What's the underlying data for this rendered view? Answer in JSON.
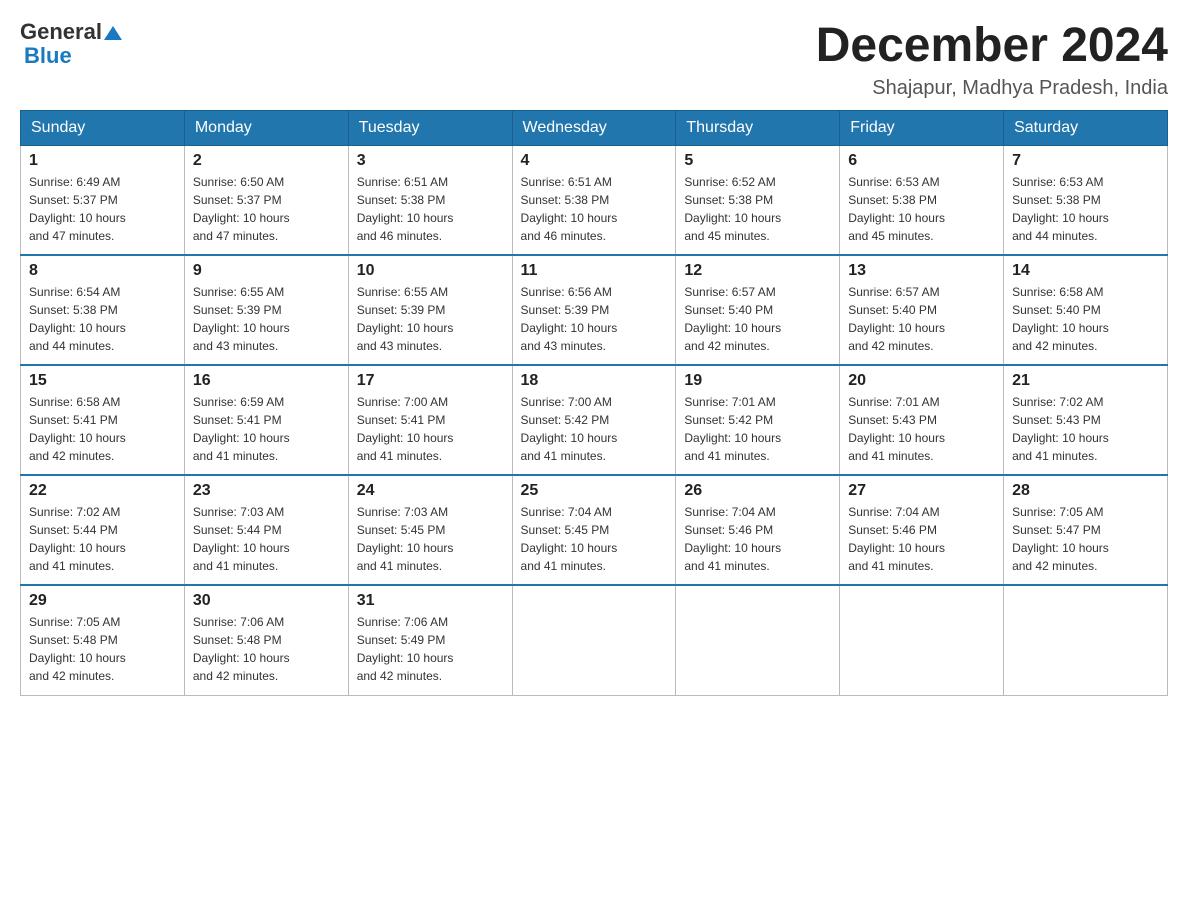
{
  "header": {
    "logo_general": "General",
    "logo_blue": "Blue",
    "month_year": "December 2024",
    "location": "Shajapur, Madhya Pradesh, India"
  },
  "weekdays": [
    "Sunday",
    "Monday",
    "Tuesday",
    "Wednesday",
    "Thursday",
    "Friday",
    "Saturday"
  ],
  "weeks": [
    [
      {
        "day": "1",
        "sunrise": "6:49 AM",
        "sunset": "5:37 PM",
        "daylight": "10 hours and 47 minutes."
      },
      {
        "day": "2",
        "sunrise": "6:50 AM",
        "sunset": "5:37 PM",
        "daylight": "10 hours and 47 minutes."
      },
      {
        "day": "3",
        "sunrise": "6:51 AM",
        "sunset": "5:38 PM",
        "daylight": "10 hours and 46 minutes."
      },
      {
        "day": "4",
        "sunrise": "6:51 AM",
        "sunset": "5:38 PM",
        "daylight": "10 hours and 46 minutes."
      },
      {
        "day": "5",
        "sunrise": "6:52 AM",
        "sunset": "5:38 PM",
        "daylight": "10 hours and 45 minutes."
      },
      {
        "day": "6",
        "sunrise": "6:53 AM",
        "sunset": "5:38 PM",
        "daylight": "10 hours and 45 minutes."
      },
      {
        "day": "7",
        "sunrise": "6:53 AM",
        "sunset": "5:38 PM",
        "daylight": "10 hours and 44 minutes."
      }
    ],
    [
      {
        "day": "8",
        "sunrise": "6:54 AM",
        "sunset": "5:38 PM",
        "daylight": "10 hours and 44 minutes."
      },
      {
        "day": "9",
        "sunrise": "6:55 AM",
        "sunset": "5:39 PM",
        "daylight": "10 hours and 43 minutes."
      },
      {
        "day": "10",
        "sunrise": "6:55 AM",
        "sunset": "5:39 PM",
        "daylight": "10 hours and 43 minutes."
      },
      {
        "day": "11",
        "sunrise": "6:56 AM",
        "sunset": "5:39 PM",
        "daylight": "10 hours and 43 minutes."
      },
      {
        "day": "12",
        "sunrise": "6:57 AM",
        "sunset": "5:40 PM",
        "daylight": "10 hours and 42 minutes."
      },
      {
        "day": "13",
        "sunrise": "6:57 AM",
        "sunset": "5:40 PM",
        "daylight": "10 hours and 42 minutes."
      },
      {
        "day": "14",
        "sunrise": "6:58 AM",
        "sunset": "5:40 PM",
        "daylight": "10 hours and 42 minutes."
      }
    ],
    [
      {
        "day": "15",
        "sunrise": "6:58 AM",
        "sunset": "5:41 PM",
        "daylight": "10 hours and 42 minutes."
      },
      {
        "day": "16",
        "sunrise": "6:59 AM",
        "sunset": "5:41 PM",
        "daylight": "10 hours and 41 minutes."
      },
      {
        "day": "17",
        "sunrise": "7:00 AM",
        "sunset": "5:41 PM",
        "daylight": "10 hours and 41 minutes."
      },
      {
        "day": "18",
        "sunrise": "7:00 AM",
        "sunset": "5:42 PM",
        "daylight": "10 hours and 41 minutes."
      },
      {
        "day": "19",
        "sunrise": "7:01 AM",
        "sunset": "5:42 PM",
        "daylight": "10 hours and 41 minutes."
      },
      {
        "day": "20",
        "sunrise": "7:01 AM",
        "sunset": "5:43 PM",
        "daylight": "10 hours and 41 minutes."
      },
      {
        "day": "21",
        "sunrise": "7:02 AM",
        "sunset": "5:43 PM",
        "daylight": "10 hours and 41 minutes."
      }
    ],
    [
      {
        "day": "22",
        "sunrise": "7:02 AM",
        "sunset": "5:44 PM",
        "daylight": "10 hours and 41 minutes."
      },
      {
        "day": "23",
        "sunrise": "7:03 AM",
        "sunset": "5:44 PM",
        "daylight": "10 hours and 41 minutes."
      },
      {
        "day": "24",
        "sunrise": "7:03 AM",
        "sunset": "5:45 PM",
        "daylight": "10 hours and 41 minutes."
      },
      {
        "day": "25",
        "sunrise": "7:04 AM",
        "sunset": "5:45 PM",
        "daylight": "10 hours and 41 minutes."
      },
      {
        "day": "26",
        "sunrise": "7:04 AM",
        "sunset": "5:46 PM",
        "daylight": "10 hours and 41 minutes."
      },
      {
        "day": "27",
        "sunrise": "7:04 AM",
        "sunset": "5:46 PM",
        "daylight": "10 hours and 41 minutes."
      },
      {
        "day": "28",
        "sunrise": "7:05 AM",
        "sunset": "5:47 PM",
        "daylight": "10 hours and 42 minutes."
      }
    ],
    [
      {
        "day": "29",
        "sunrise": "7:05 AM",
        "sunset": "5:48 PM",
        "daylight": "10 hours and 42 minutes."
      },
      {
        "day": "30",
        "sunrise": "7:06 AM",
        "sunset": "5:48 PM",
        "daylight": "10 hours and 42 minutes."
      },
      {
        "day": "31",
        "sunrise": "7:06 AM",
        "sunset": "5:49 PM",
        "daylight": "10 hours and 42 minutes."
      },
      null,
      null,
      null,
      null
    ]
  ],
  "labels": {
    "sunrise_prefix": "Sunrise: ",
    "sunset_prefix": "Sunset: ",
    "daylight_prefix": "Daylight: "
  }
}
